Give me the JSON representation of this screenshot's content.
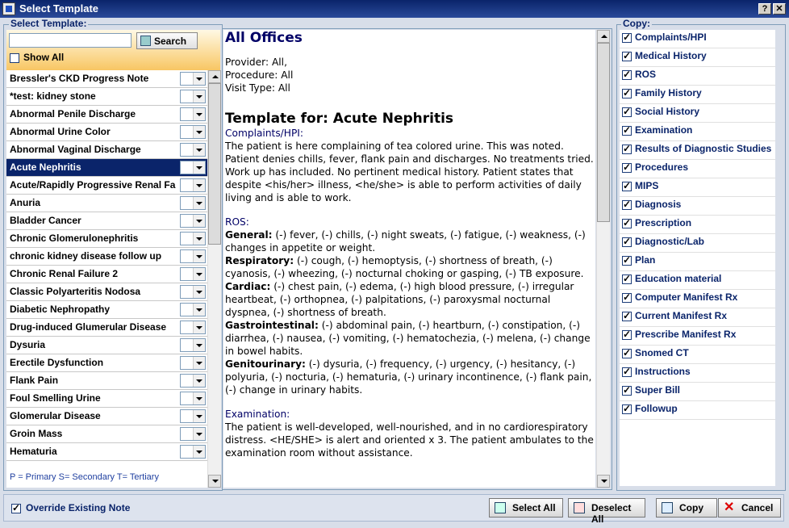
{
  "window": {
    "title": "Select Template",
    "help_label": "?",
    "close_label": "✕"
  },
  "select_template": {
    "label": "Select Template:",
    "search_value": "",
    "search_button": "Search",
    "show_all_label": "Show All",
    "show_all_checked": false,
    "templates": [
      "Bressler's CKD Progress Note",
      "*test: kidney stone",
      "Abnormal Penile Discharge",
      "Abnormal Urine Color",
      "Abnormal Vaginal Discharge",
      "Acute Nephritis",
      "Acute/Rapidly Progressive Renal Fa",
      "Anuria",
      "Bladder Cancer",
      "Chronic Glomerulonephritis",
      "chronic kidney disease follow up",
      "Chronic Renal Failure 2",
      "Classic Polyarteritis Nodosa",
      "Diabetic Nephropathy",
      "Drug-induced Glumerular Disease",
      "Dysuria",
      "Erectile Dysfunction",
      "Flank Pain",
      "Foul Smelling Urine",
      "Glomerular Disease",
      "Groin Mass",
      "Hematuria"
    ],
    "selected_template": "Acute Nephritis",
    "legend": "P = Primary S= Secondary T= Tertiary"
  },
  "preview": {
    "office": "All Offices",
    "provider_label": "Provider:",
    "provider_value": "All,",
    "procedure_label": "Procedure:",
    "procedure_value": "All",
    "visit_type_label": "Visit Type:",
    "visit_type_value": "All",
    "template_heading": "Template for: Acute Nephritis",
    "complaints_heading": "Complaints/HPI:",
    "complaints_text": "The patient is here complaining of tea colored urine.  This was noted. Patient denies chills, fever, flank pain and discharges. No treatments tried.  Work up has included. No pertinent medical history. Patient states that despite <his/her> illness, <he/she> is able to perform activities of daily living and is able to work.",
    "ros_heading": "ROS:",
    "ros": [
      {
        "label": "General:",
        "text": " (-) fever, (-) chills, (-) night sweats, (-) fatigue, (-) weakness, (-) changes in appetite or weight."
      },
      {
        "label": "Respiratory:",
        "text": " (-) cough, (-) hemoptysis, (-) shortness of breath, (-) cyanosis, (-) wheezing, (-) nocturnal choking or gasping, (-) TB exposure."
      },
      {
        "label": "Cardiac:",
        "text": " (-) chest pain, (-) edema, (-) high blood pressure, (-) irregular heartbeat, (-) orthopnea, (-) palpitations, (-) paroxysmal nocturnal dyspnea, (-) shortness of breath."
      },
      {
        "label": "Gastrointestinal:",
        "text": " (-) abdominal pain, (-) heartburn, (-) constipation, (-) diarrhea, (-) nausea, (-) vomiting, (-) hematochezia, (-) melena, (-) change in bowel habits."
      },
      {
        "label": "Genitourinary:",
        "text": " (-) dysuria, (-) frequency, (-) urgency, (-) hesitancy, (-) polyuria, (-) nocturia, (-) hematuria, (-) urinary incontinence, (-) flank pain, (-) change in urinary habits."
      }
    ],
    "exam_heading": "Examination:",
    "exam_text": "The patient is well-developed, well-nourished, and in no cardiorespiratory distress. <HE/SHE> is alert and oriented x 3. The patient ambulates to the examination room without assistance."
  },
  "copy": {
    "label": "Copy:",
    "items": [
      "Complaints/HPI",
      "Medical History",
      "ROS",
      "Family History",
      "Social History",
      "Examination",
      "Results of Diagnostic Studies",
      "Procedures",
      "MIPS",
      "Diagnosis",
      "Prescription",
      "Diagnostic/Lab",
      "Plan",
      "Education material",
      "Computer Manifest Rx",
      "Current Manifest Rx",
      "Prescribe Manifest Rx",
      "Snomed CT",
      "Instructions",
      "Super Bill",
      "Followup"
    ],
    "all_checked": true
  },
  "footer": {
    "override_label": "Override Existing Note",
    "override_checked": true,
    "select_all": "Select All",
    "deselect_all": "Deselect All",
    "copy": "Copy",
    "cancel": "Cancel"
  }
}
